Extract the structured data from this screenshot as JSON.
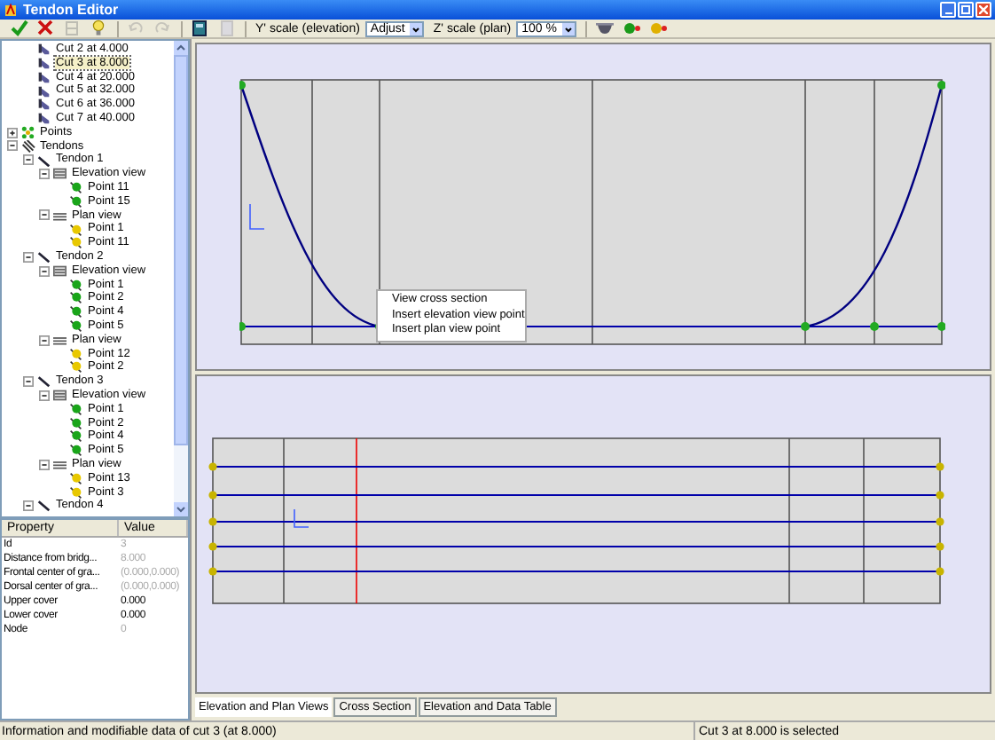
{
  "window": {
    "title": "Tendon Editor"
  },
  "toolbar": {
    "buttons": [
      {
        "disabled": false
      },
      {
        "disabled": false
      },
      {
        "disabled": true
      },
      {
        "disabled": false
      },
      {
        "disabled": true
      },
      {
        "disabled": true
      },
      {
        "disabled": false
      },
      {
        "disabled": true
      }
    ],
    "y_scale": {
      "label": "Y' scale (elevation)",
      "value": "Adjust"
    },
    "z_scale": {
      "label": "Z' scale (plan)",
      "value": "100 %"
    },
    "extra_buttons": [
      {
        "disabled": false
      },
      {
        "disabled": false
      },
      {
        "disabled": false
      }
    ]
  },
  "tree": {
    "scrolled_items": [
      {
        "label": "Cut 2 at 4.000",
        "kind": "cut",
        "selected": false
      },
      {
        "label": "Cut 3 at 8.000",
        "kind": "cut",
        "selected": true
      },
      {
        "label": "Cut 4 at 20.000",
        "kind": "cut",
        "selected": false
      },
      {
        "label": "Cut 5 at 32.000",
        "kind": "cut",
        "selected": false
      },
      {
        "label": "Cut 6 at 36.000",
        "kind": "cut",
        "selected": false
      },
      {
        "label": "Cut 7 at 40.000",
        "kind": "cut",
        "selected": false
      }
    ],
    "items": [
      {
        "label": "Points",
        "kind": "points",
        "selected": false,
        "expanded": false
      },
      {
        "label": "Tendons",
        "kind": "tendons",
        "selected": false,
        "expanded": true,
        "children": [
          {
            "label": "Tendon 1",
            "kind": "tendon",
            "selected": false,
            "expanded": true,
            "children": [
              {
                "label": "Elevation view",
                "kind": "elevation",
                "selected": false,
                "expanded": true,
                "children": [
                  {
                    "label": "Point 11",
                    "kind": "gpoint",
                    "selected": false
                  },
                  {
                    "label": "Point 15",
                    "kind": "gpoint",
                    "selected": false
                  }
                ]
              },
              {
                "label": "Plan view",
                "kind": "plan",
                "selected": false,
                "expanded": true,
                "children": [
                  {
                    "label": "Point 1",
                    "kind": "ypoint",
                    "selected": false
                  },
                  {
                    "label": "Point 11",
                    "kind": "ypoint",
                    "selected": false
                  }
                ]
              }
            ]
          },
          {
            "label": "Tendon 2",
            "kind": "tendon",
            "selected": false,
            "expanded": true,
            "children": [
              {
                "label": "Elevation view",
                "kind": "elevation",
                "selected": false,
                "expanded": true,
                "children": [
                  {
                    "label": "Point 1",
                    "kind": "gpoint",
                    "selected": false
                  },
                  {
                    "label": "Point 2",
                    "kind": "gpoint",
                    "selected": false
                  },
                  {
                    "label": "Point 4",
                    "kind": "gpoint",
                    "selected": false
                  },
                  {
                    "label": "Point 5",
                    "kind": "gpoint",
                    "selected": false
                  }
                ]
              },
              {
                "label": "Plan view",
                "kind": "plan",
                "selected": false,
                "expanded": true,
                "children": [
                  {
                    "label": "Point 12",
                    "kind": "ypoint",
                    "selected": false
                  },
                  {
                    "label": "Point 2",
                    "kind": "ypoint",
                    "selected": false
                  }
                ]
              }
            ]
          },
          {
            "label": "Tendon 3",
            "kind": "tendon",
            "selected": false,
            "expanded": true,
            "children": [
              {
                "label": "Elevation view",
                "kind": "elevation",
                "selected": false,
                "expanded": true,
                "children": [
                  {
                    "label": "Point 1",
                    "kind": "gpoint",
                    "selected": false
                  },
                  {
                    "label": "Point 2",
                    "kind": "gpoint",
                    "selected": false
                  },
                  {
                    "label": "Point 4",
                    "kind": "gpoint",
                    "selected": false
                  },
                  {
                    "label": "Point 5",
                    "kind": "gpoint",
                    "selected": false
                  }
                ]
              },
              {
                "label": "Plan view",
                "kind": "plan",
                "selected": false,
                "expanded": true,
                "children": [
                  {
                    "label": "Point 13",
                    "kind": "ypoint",
                    "selected": false
                  },
                  {
                    "label": "Point 3",
                    "kind": "ypoint",
                    "selected": false
                  }
                ]
              }
            ]
          },
          {
            "label": "Tendon 4",
            "kind": "tendon",
            "selected": false,
            "expanded": true
          }
        ]
      }
    ]
  },
  "properties": {
    "columns": [
      "Property",
      "Value"
    ],
    "rows": [
      {
        "name": "Id",
        "value": "3",
        "readonly": true
      },
      {
        "name": "Distance from bridg...",
        "value": "8.000",
        "readonly": true
      },
      {
        "name": "Frontal center of gra...",
        "value": "(0.000,0.000)",
        "readonly": true
      },
      {
        "name": "Dorsal center of gra...",
        "value": "(0.000,0.000)",
        "readonly": true
      },
      {
        "name": "Upper cover",
        "value": "0.000",
        "readonly": false
      },
      {
        "name": "Lower cover",
        "value": "0.000",
        "readonly": false
      },
      {
        "name": "Node",
        "value": "0",
        "readonly": true
      }
    ]
  },
  "context_menu": [
    "View cross section",
    "Insert elevation view point",
    "Insert plan view point"
  ],
  "tabs": [
    {
      "label": "Elevation and Plan Views",
      "selected": true
    },
    {
      "label": "Cross Section",
      "selected": false
    },
    {
      "label": "Elevation and Data Table",
      "selected": false
    }
  ],
  "status_bar": {
    "left": "Information and modifiable data of cut 3 (at 8.000)",
    "right": "Cut 3 at 8.000 is selected"
  }
}
